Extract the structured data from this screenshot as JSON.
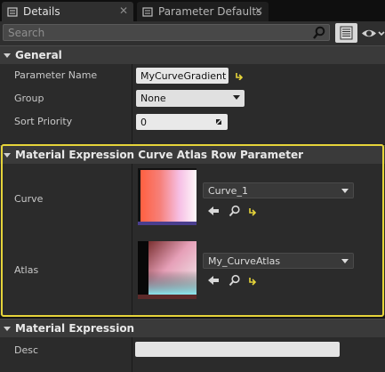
{
  "tabs": [
    {
      "label": "Details",
      "icon": "details-tab-icon",
      "close": "✕"
    },
    {
      "label": "Parameter Defaults",
      "icon": "parameter-defaults-tab-icon",
      "close": "✕"
    }
  ],
  "search": {
    "placeholder": "Search"
  },
  "sections": {
    "general": {
      "title": "General",
      "rows": {
        "parameter_name": {
          "label": "Parameter Name",
          "value": "MyCurveGradient"
        },
        "group": {
          "label": "Group",
          "value": "None"
        },
        "sort_priority": {
          "label": "Sort Priority",
          "value": "0"
        }
      }
    },
    "atlas_param": {
      "title": "Material Expression Curve Atlas Row Parameter",
      "rows": {
        "curve": {
          "label": "Curve",
          "value": "Curve_1"
        },
        "atlas": {
          "label": "Atlas",
          "value": "My_CurveAtlas"
        }
      }
    },
    "material_expression": {
      "title": "Material Expression",
      "rows": {
        "desc": {
          "label": "Desc",
          "value": ""
        }
      }
    }
  },
  "colors": {
    "highlight_border": "#e6d43a",
    "reset_arrow": "#e6d43a",
    "panel_bg": "#2b2b2b",
    "category_bg": "#3a3a3a"
  }
}
